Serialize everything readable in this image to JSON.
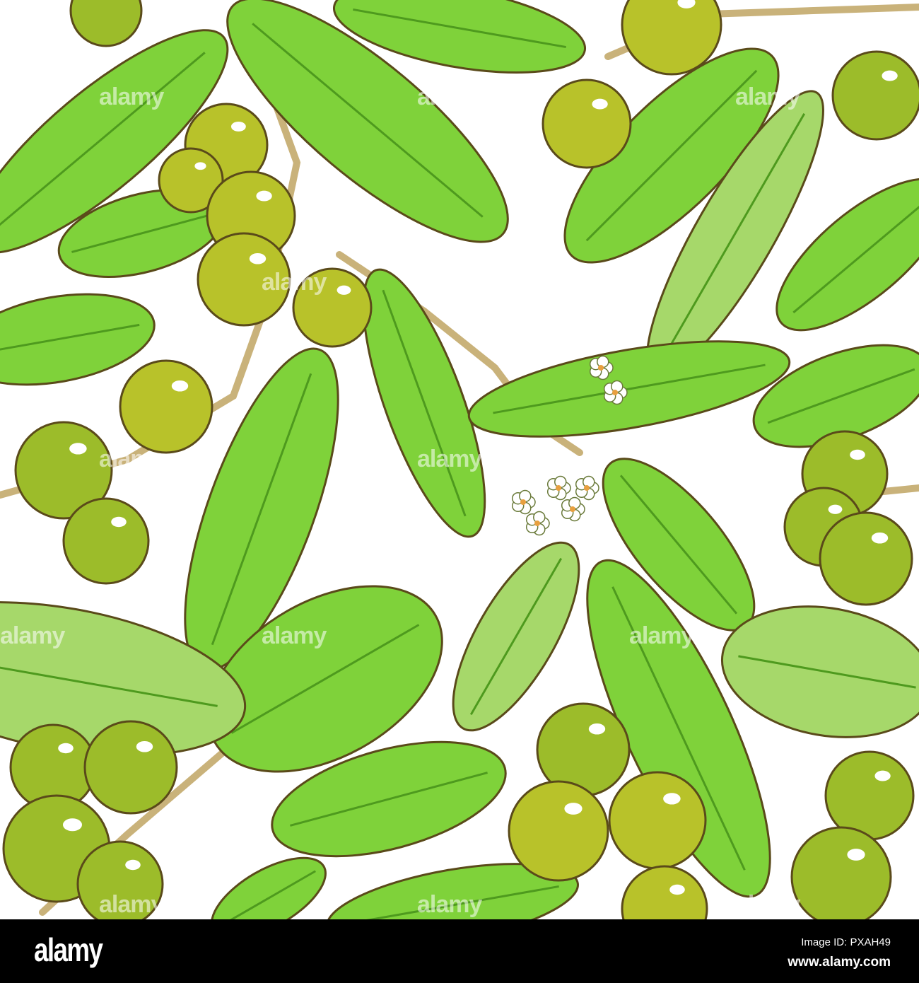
{
  "illustration": {
    "subject": "shea branches pattern",
    "colors": {
      "leaf": "#7fd23a",
      "leaf_light": "#a6d86a",
      "leaf_dark": "#4e9a1e",
      "outline": "#5a4a1a",
      "fruit": "#b8c22a",
      "fruit_light": "#d9d94a",
      "fruit_green": "#9cbc2a",
      "stem": "#c9b27a",
      "flower": "#ffffff",
      "background": "#ffffff"
    }
  },
  "watermark": {
    "text": "alamy"
  },
  "footer": {
    "logo": "alamy",
    "image_id": "Image ID: PXAH49",
    "url": "www.alamy.com"
  }
}
